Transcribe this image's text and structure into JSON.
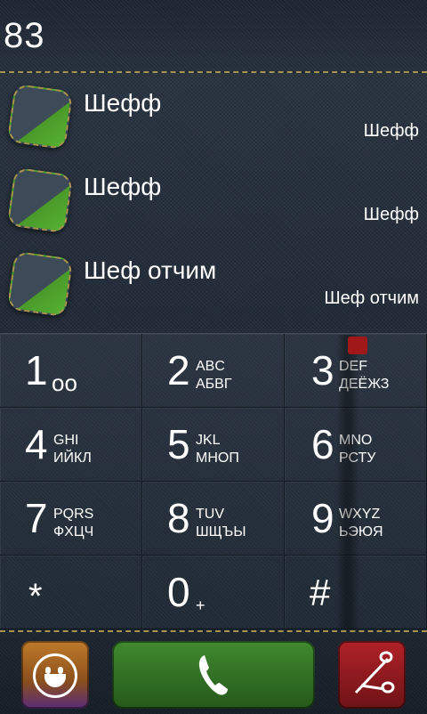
{
  "dialer": {
    "number": "83"
  },
  "contacts": [
    {
      "name": "Шефф",
      "subtitle": "Шефф"
    },
    {
      "name": "Шефф",
      "subtitle": "Шефф"
    },
    {
      "name": "Шеф отчим",
      "subtitle": "Шеф отчим"
    }
  ],
  "keys": {
    "k1": {
      "digit": "1",
      "symbol": "ᴏᴏ"
    },
    "k2": {
      "digit": "2",
      "latin": "ABC",
      "cyr": "АБВГ"
    },
    "k3": {
      "digit": "3",
      "latin": "DEF",
      "cyr": "ДЕЁЖЗ"
    },
    "k4": {
      "digit": "4",
      "latin": "GHI",
      "cyr": "ИЙКЛ"
    },
    "k5": {
      "digit": "5",
      "latin": "JKL",
      "cyr": "МНОП"
    },
    "k6": {
      "digit": "6",
      "latin": "MNO",
      "cyr": "РСТУ"
    },
    "k7": {
      "digit": "7",
      "latin": "PQRS",
      "cyr": "ФХЦЧ"
    },
    "k8": {
      "digit": "8",
      "latin": "TUV",
      "cyr": "ШЩЪЫ"
    },
    "k9": {
      "digit": "9",
      "latin": "WXYZ",
      "cyr": "ЬЭЮЯ"
    },
    "star": {
      "digit": "*"
    },
    "k0": {
      "digit": "0",
      "plus": "+"
    },
    "hash": {
      "digit": "#"
    }
  },
  "icons": {
    "voicemail": "voicemail-icon",
    "contacts_button": "smiley-icon",
    "call_button": "phone-icon",
    "delete_button": "scissors-icon"
  },
  "colors": {
    "stitch": "#a8934e",
    "call_green": "#3f8a2e",
    "delete_red": "#b02228",
    "contacts_orange": "#c07a2a"
  }
}
